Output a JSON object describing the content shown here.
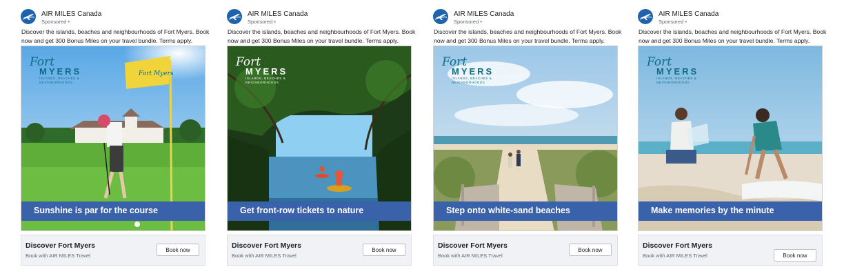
{
  "ads": [
    {
      "advertiser": "AIR MILES Canada",
      "sponsored": "Sponsored •",
      "copy": "Discover the islands, beaches and neighbourhoods of Fort Myers. Book now and get 300 Bonus Miles on your travel bundle. Terms apply.",
      "logo": {
        "fort": "Fort",
        "myers": "MYERS",
        "tagline": "ISLANDS, BEACHES & NEIGHBORHOODS"
      },
      "flag_text": "Fort Myers",
      "banner": "Sunshine is par for the course",
      "footer_title": "Discover Fort Myers",
      "footer_sub": "Book with AIR MILES Travel",
      "cta": "Book now"
    },
    {
      "advertiser": "AIR MILES Canada",
      "sponsored": "Sponsored •",
      "copy": "Discover the islands, beaches and neighbourhoods of Fort Myers. Book now and get 300 Bonus Miles on your travel bundle. Terms apply.",
      "logo": {
        "fort": "Fort",
        "myers": "MYERS",
        "tagline": "ISLANDS, BEACHES & NEIGHBORHOODS"
      },
      "banner": "Get front-row tickets to nature",
      "footer_title": "Discover Fort Myers",
      "footer_sub": "Book with AIR MILES Travel",
      "cta": "Book now"
    },
    {
      "advertiser": "AIR MILES Canada",
      "sponsored": "Sponsored •",
      "copy": "Discover the islands, beaches and neighbourhoods of Fort Myers. Book now and get 300 Bonus Miles on your travel bundle. Terms apply.",
      "logo": {
        "fort": "Fort",
        "myers": "MYERS",
        "tagline": "ISLANDS, BEACHES & NEIGHBORHOODS"
      },
      "banner": "Step onto white-sand beaches",
      "footer_title": "Discover Fort Myers",
      "footer_sub": "Book with AIR MILES Travel",
      "cta": "Book now"
    },
    {
      "advertiser": "AIR MILES Canada",
      "sponsored": "Sponsored •",
      "copy": "Discover the islands, beaches and neighbourhoods of Fort Myers. Book now and get 300 Bonus Miles on your travel bundle. Terms apply.",
      "logo": {
        "fort": "Fort",
        "myers": "MYERS",
        "tagline": "ISLANDS, BEACHES & NEIGHBORHOODS"
      },
      "banner": "Make memories by the minute",
      "footer_title": "Discover Fort Myers",
      "footer_sub": "Book with AIR MILES Travel",
      "cta": "Book now"
    }
  ],
  "colors": {
    "banner": "#3a62aa",
    "logo_teal": "#0d6d86",
    "airmiles_blue": "#1f63ad"
  },
  "icons": {
    "advertiser_logo": "air-miles-plane-icon"
  }
}
